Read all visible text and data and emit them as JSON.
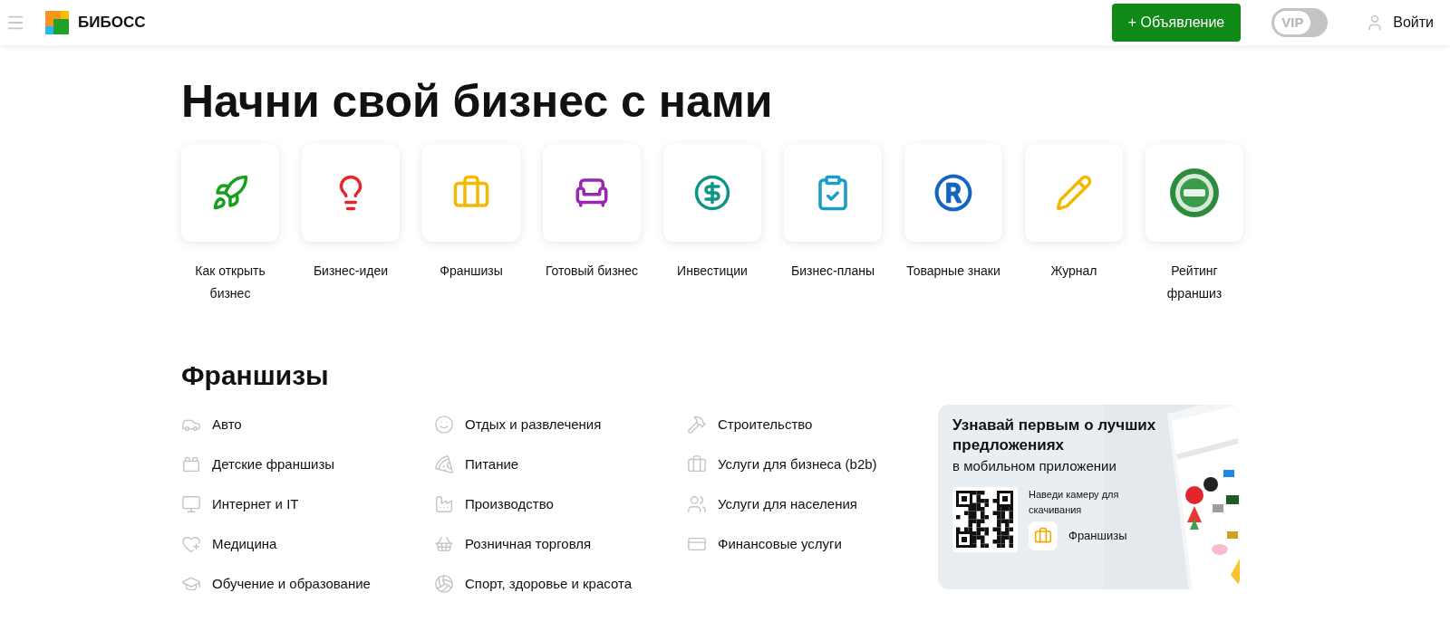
{
  "header": {
    "logo_text": "БИБОСС",
    "post_button": "+ Объявление",
    "vip_toggle": {
      "label": "VIP",
      "on": false
    },
    "login": "Войти"
  },
  "title": "Начни свой бизнес с нами",
  "tiles": [
    {
      "label": "Как открыть бизнес"
    },
    {
      "label": "Бизнес-идеи"
    },
    {
      "label": "Франшизы"
    },
    {
      "label": "Готовый бизнес"
    },
    {
      "label": "Инвестиции"
    },
    {
      "label": "Бизнес-планы"
    },
    {
      "label": "Товарные знаки"
    },
    {
      "label": "Журнал"
    },
    {
      "label": "Рейтинг франшиз"
    }
  ],
  "franchises": {
    "heading": "Франшизы",
    "columns": [
      [
        "Авто",
        "Детские франшизы",
        "Интернет и IT",
        "Медицина",
        "Обучение и образование"
      ],
      [
        "Отдых и развлечения",
        "Питание",
        "Производство",
        "Розничная торговля",
        "Спорт, здоровье и красота"
      ],
      [
        "Строительство",
        "Услуги для бизнеса (b2b)",
        "Услуги для населения",
        "Финансовые услуги"
      ]
    ]
  },
  "app_banner": {
    "title": "Узнавай первым о лучших предложениях",
    "subtitle": "в мобильном приложении",
    "qr_hint": "Наведи камеру для скачивания",
    "app_name": "Франшизы"
  }
}
